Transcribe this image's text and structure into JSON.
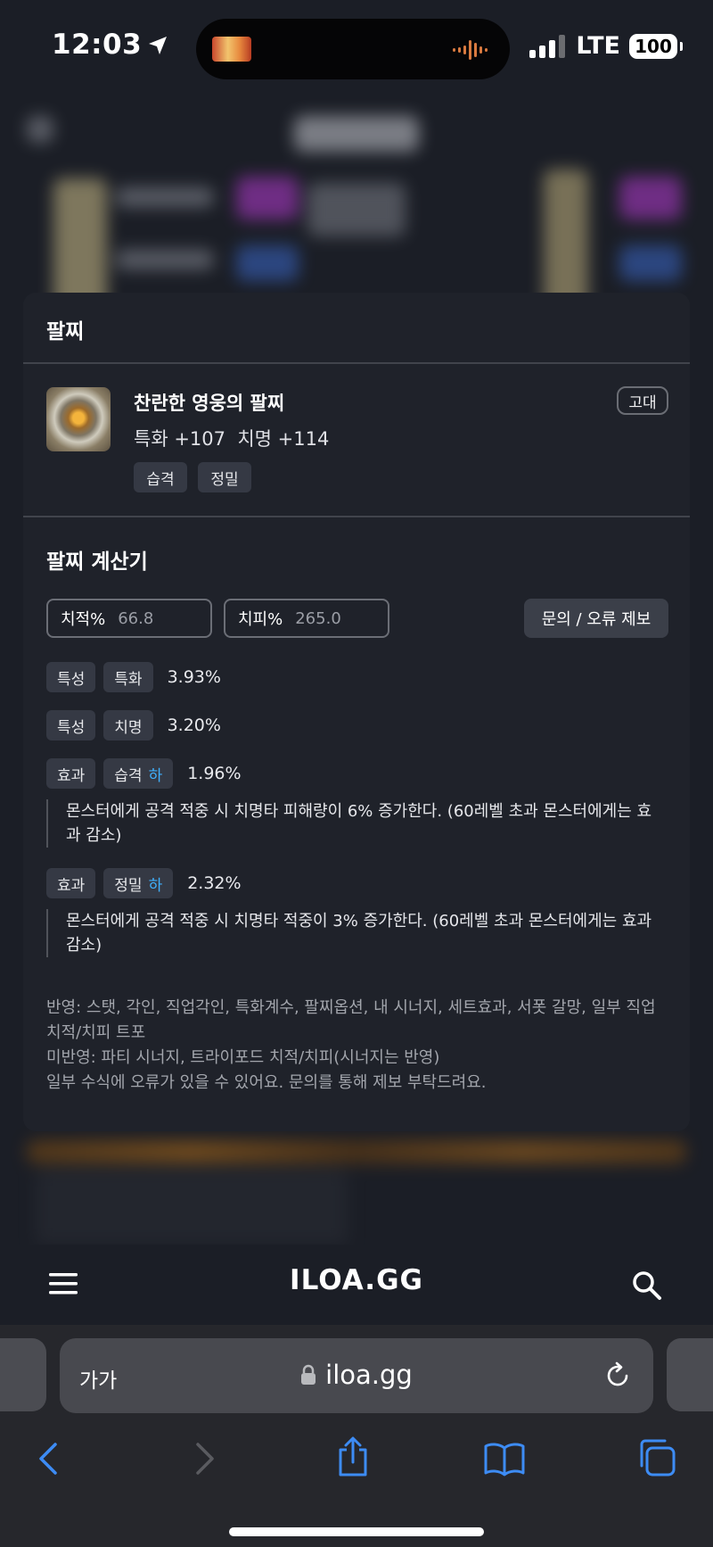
{
  "status_bar": {
    "time": "12:03",
    "network": "LTE",
    "battery": "100"
  },
  "popup": {
    "section_title": "팔찌",
    "item": {
      "name": "찬란한 영웅의 팔찌",
      "stats": "특화 +107  치명 +114",
      "grade": "고대",
      "tags": [
        "습격",
        "정밀"
      ]
    },
    "calculator": {
      "title": "팔찌 계산기",
      "crit_rate": {
        "label": "치적%",
        "value": "66.8"
      },
      "crit_damage": {
        "label": "치피%",
        "value": "265.0"
      },
      "report_button": "문의 / 오류 제보",
      "rows": [
        {
          "kind": "특성",
          "name": "특화",
          "level": "",
          "percent": "3.93%"
        },
        {
          "kind": "특성",
          "name": "치명",
          "level": "",
          "percent": "3.20%"
        },
        {
          "kind": "효과",
          "name": "습격",
          "level": "하",
          "percent": "1.96%",
          "desc": "몬스터에게 공격 적중 시 치명타 피해량이 6% 증가한다. (60레벨 초과 몬스터에게는 효과 감소)"
        },
        {
          "kind": "효과",
          "name": "정밀",
          "level": "하",
          "percent": "2.32%",
          "desc": "몬스터에게 공격 적중 시 치명타 적중이 3% 증가한다. (60레벨 초과 몬스터에게는 효과 감소)"
        }
      ],
      "notes": [
        "반영: 스탯, 각인, 직업각인, 특화계수, 팔찌옵션, 내 시너지, 세트효과, 서폿 갈망, 일부 직업 치적/치피 트포",
        "미반영: 파티 시너지, 트라이포드 치적/치피(시너지는 반영)",
        "일부 수식에 오류가 있을 수 있어요. 문의를 통해 제보 부탁드려요."
      ]
    }
  },
  "site_nav": {
    "brand": "ILOA.GG",
    "menu_icon": "hamburger-icon",
    "search_icon": "search-icon"
  },
  "browser": {
    "aa_label": "가가",
    "url": "iloa.gg",
    "toolbar_icons": [
      "back-icon",
      "forward-icon",
      "share-icon",
      "bookmarks-icon",
      "tabs-icon"
    ]
  },
  "colors": {
    "accent_blue": "#3fb1ff",
    "safari_blue": "#3d8cf5",
    "card_bg": "#1f222a"
  }
}
